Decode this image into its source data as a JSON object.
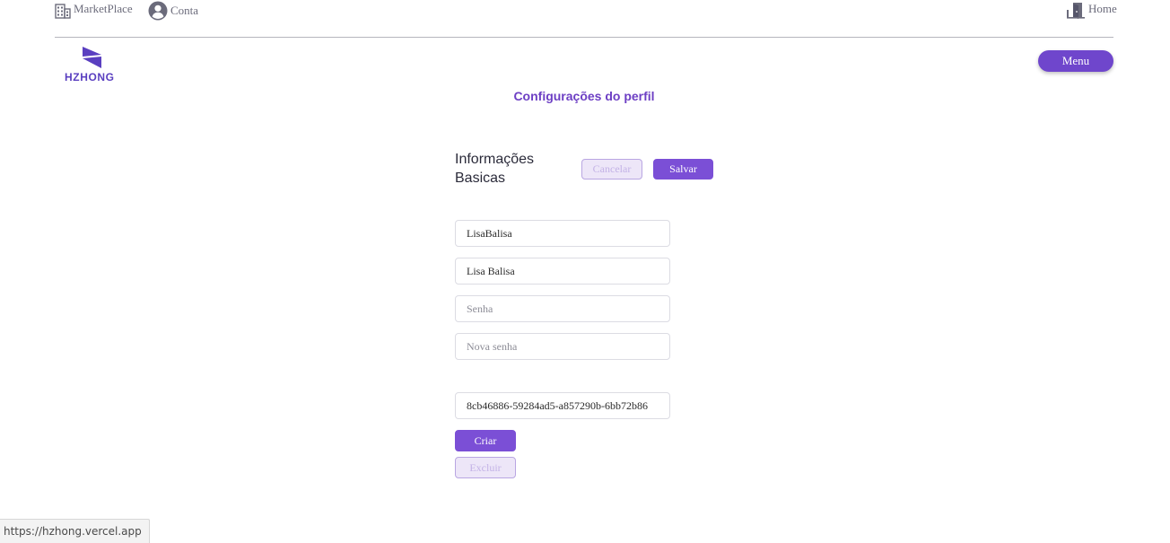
{
  "topbar": {
    "marketplace_label": "MarketPlace",
    "conta_label": "Conta",
    "home_label": "Home"
  },
  "logo": {
    "text": "HZHONG"
  },
  "menu": {
    "label": "Menu"
  },
  "page": {
    "title": "Configurações do perfil"
  },
  "basic_info": {
    "title": "Informações Basicas",
    "cancel_label": "Cancelar",
    "save_label": "Salvar"
  },
  "form": {
    "username": {
      "value": "LisaBalisa"
    },
    "fullname": {
      "value": "Lisa Balisa"
    },
    "password": {
      "placeholder": "Senha"
    },
    "new_password": {
      "placeholder": "Nova senha"
    },
    "token": {
      "value": "8cb46886-59284ad5-a857290b-6bb72b86"
    }
  },
  "token_actions": {
    "create_label": "Criar",
    "delete_label": "Excluir"
  },
  "statusbar": {
    "url": "https://hzhong.vercel.app"
  },
  "colors": {
    "accent": "#7b4fd6",
    "title": "#6d3fc4",
    "disabled_bg": "#ede6f8"
  },
  "icons": {
    "marketplace": "building-icon",
    "conta": "user-circle-icon",
    "home": "door-exit-icon"
  }
}
